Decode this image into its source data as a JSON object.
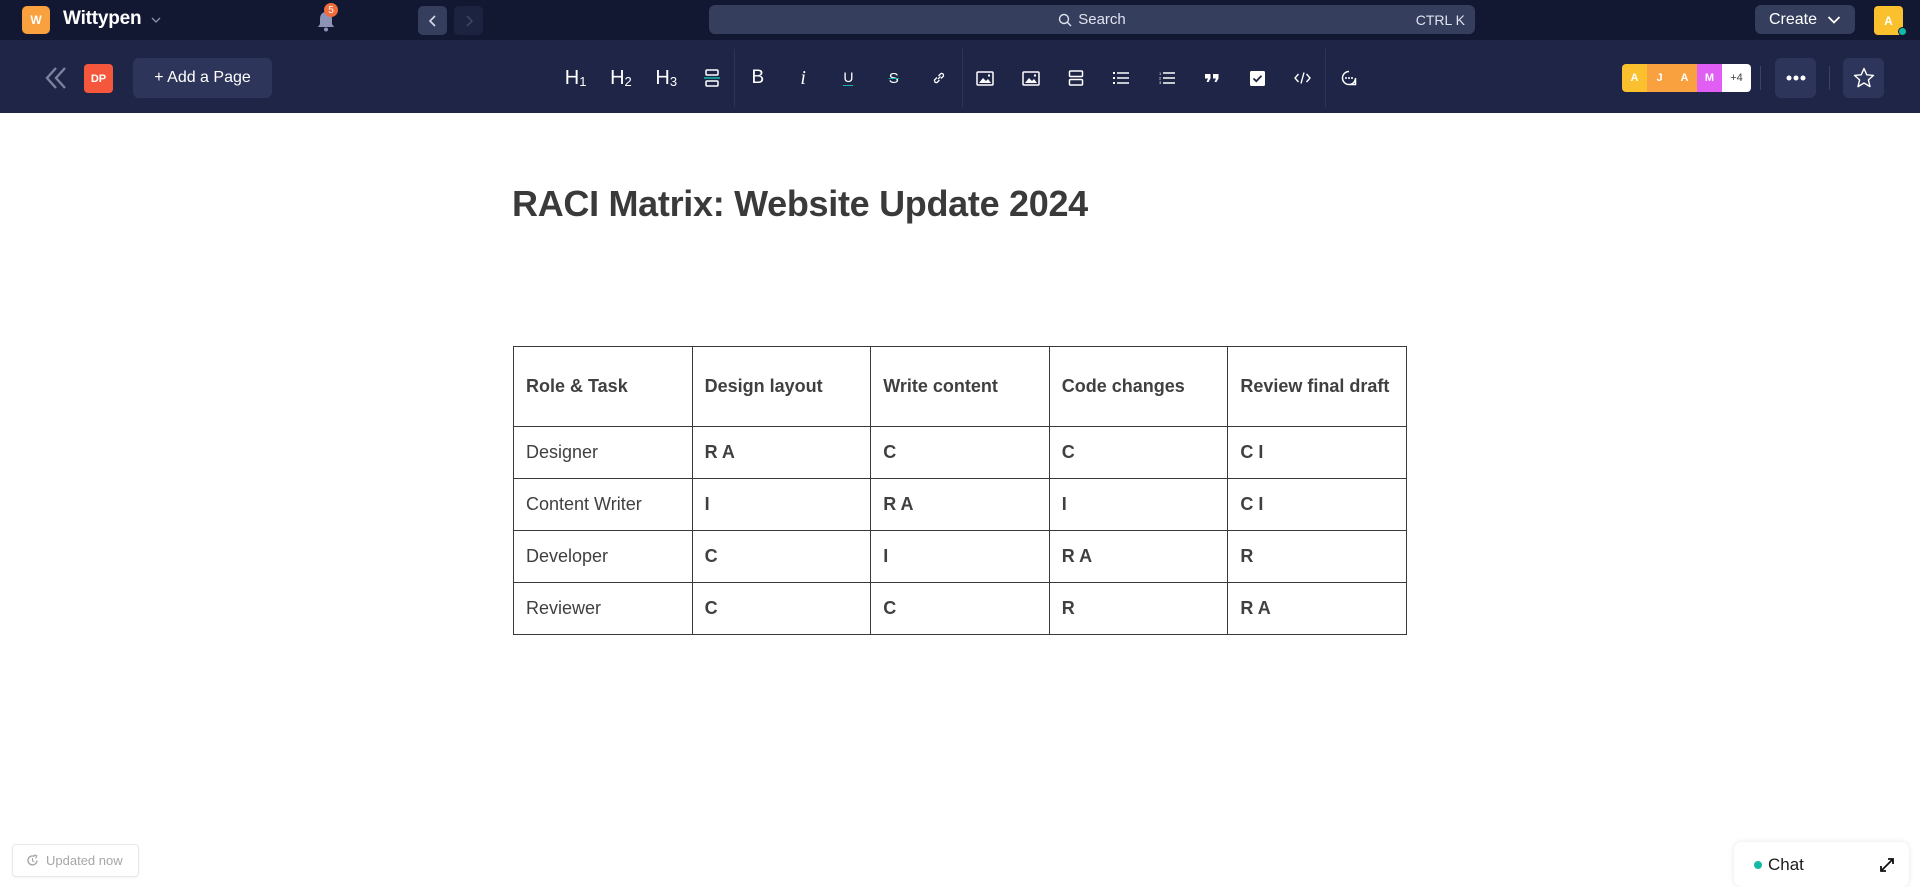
{
  "topbar": {
    "workspace_initial": "W",
    "workspace_name": "Wittypen",
    "notifications_count": "5",
    "search_placeholder": "Search",
    "search_shortcut": "CTRL K",
    "create_label": "Create",
    "user_initial": "A"
  },
  "toolbar": {
    "space_badge": "DP",
    "add_page_label": "+ Add a Page",
    "format_buttons": [
      {
        "name": "heading-1",
        "label": "H",
        "sub": "1"
      },
      {
        "name": "heading-2",
        "label": "H",
        "sub": "2"
      },
      {
        "name": "heading-3",
        "label": "H",
        "sub": "3"
      },
      {
        "name": "divider",
        "icon": "divider-icon"
      },
      {
        "name": "bold",
        "label": "B"
      },
      {
        "name": "italic",
        "label": "i"
      },
      {
        "name": "underline",
        "label": "U"
      },
      {
        "name": "strikethrough",
        "label": "S"
      },
      {
        "name": "link",
        "icon": "link-icon"
      },
      {
        "name": "image",
        "icon": "image-icon"
      },
      {
        "name": "image-gallery",
        "icon": "image-icon"
      },
      {
        "name": "layout",
        "icon": "layout-icon"
      },
      {
        "name": "bullet-list",
        "icon": "bullet-list-icon"
      },
      {
        "name": "numbered-list",
        "icon": "numbered-list-icon"
      },
      {
        "name": "quote",
        "icon": "quote-icon"
      },
      {
        "name": "checklist",
        "icon": "checkbox-icon"
      },
      {
        "name": "code",
        "icon": "code-icon"
      },
      {
        "name": "comment",
        "icon": "comment-icon"
      }
    ],
    "collaborators": [
      {
        "initial": "A",
        "color": "#fbc02d"
      },
      {
        "initial": "J",
        "color": "#f9a03f"
      },
      {
        "initial": "A",
        "color": "#f9a03f"
      },
      {
        "initial": "M",
        "color": "#e15ef5"
      }
    ],
    "collaborators_more": "+4"
  },
  "document": {
    "title": "RACI Matrix: Website Update 2024",
    "table": {
      "headers": [
        "Role & Task",
        "Design layout",
        "Write content",
        "Code changes",
        "Review final draft"
      ],
      "rows": [
        [
          "Designer",
          "R A",
          "C",
          "C",
          "C I"
        ],
        [
          "Content Writer",
          "I",
          "R A",
          "I",
          "C I"
        ],
        [
          "Developer",
          "C",
          "I",
          "R A",
          "R"
        ],
        [
          "Reviewer",
          "C",
          "C",
          "R",
          "R A"
        ]
      ]
    }
  },
  "footer": {
    "status": "Updated now",
    "chat_label": "Chat"
  },
  "colors": {
    "topbar_bg": "#121831",
    "toolbar_bg": "#1e2546",
    "accent_teal": "#14b8a6",
    "workspace_orange": "#f9a03f",
    "space_red": "#f4573c"
  }
}
